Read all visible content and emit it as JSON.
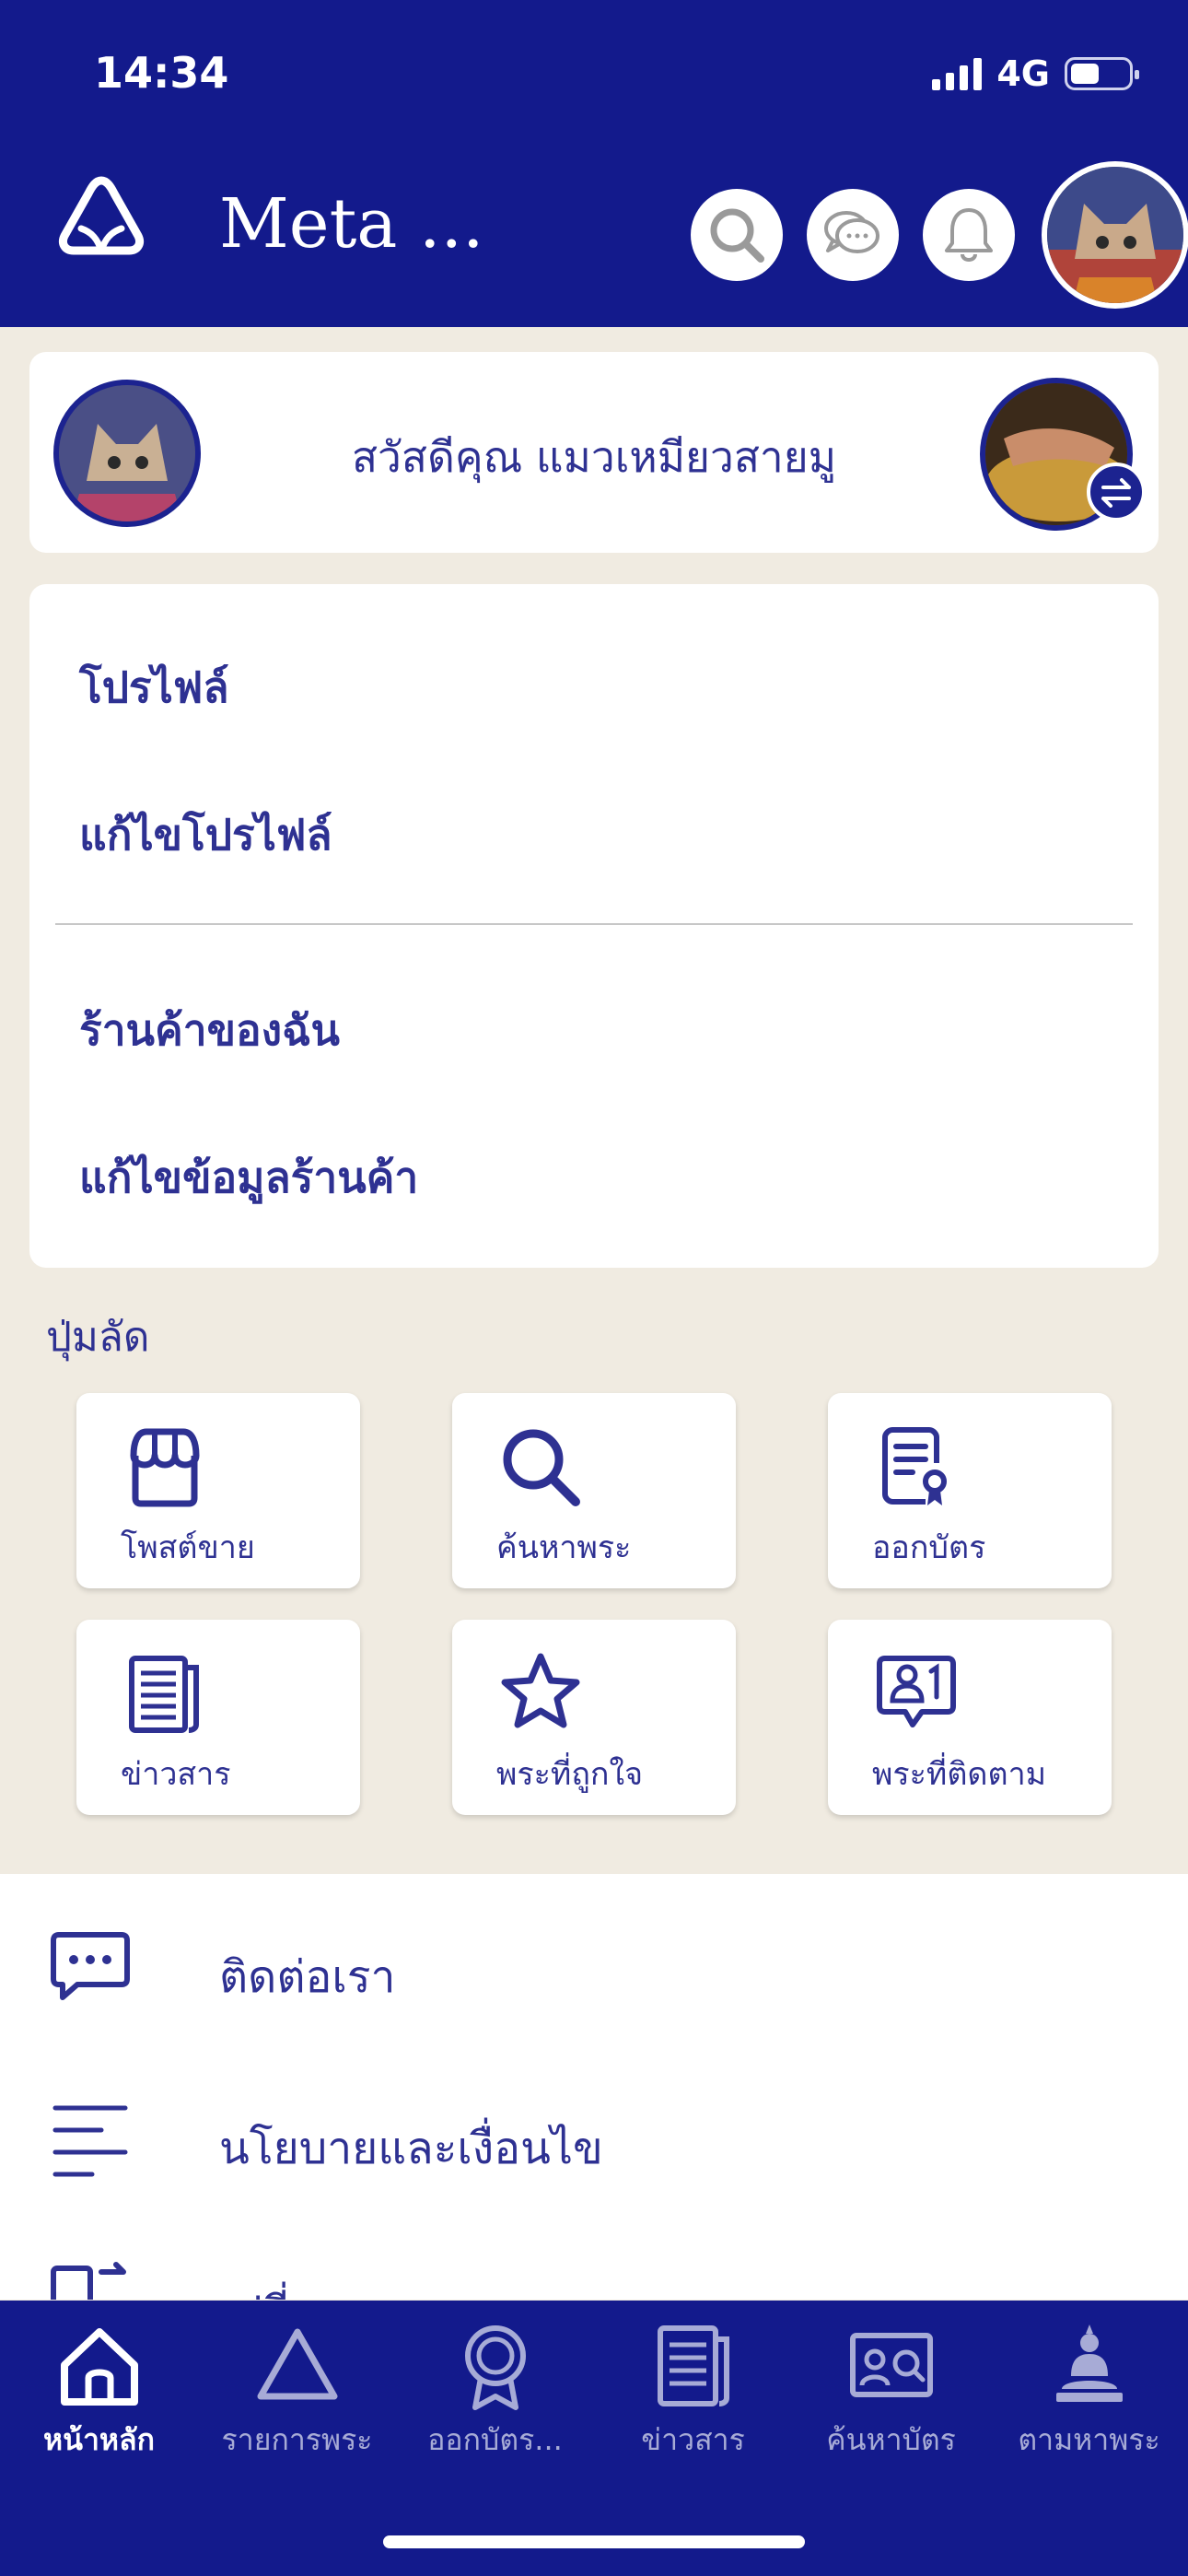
{
  "status_bar": {
    "time": "14:34",
    "network": "4G"
  },
  "app_bar": {
    "title": "Meta ..."
  },
  "greeting": {
    "text": "สวัสดีคุณ แมวเหมียวสายมู"
  },
  "profile_menu": {
    "profile": "โปรไฟล์",
    "edit_profile": "แก้ไขโปรไฟล์",
    "my_shop": "ร้านค้าของฉัน",
    "edit_shop": "แก้ไขข้อมูลร้านค้า"
  },
  "shortcuts": {
    "title": "ปุ่มลัด",
    "items": [
      {
        "label": "โพสต์ขาย",
        "icon": "shop-icon"
      },
      {
        "label": "ค้นหาพระ",
        "icon": "search-icon"
      },
      {
        "label": "ออกบัตร",
        "icon": "certificate-icon"
      },
      {
        "label": "ข่าวสาร",
        "icon": "newspaper-icon"
      },
      {
        "label": "พระที่ถูกใจ",
        "icon": "star-icon"
      },
      {
        "label": "พระที่ติดตาม",
        "icon": "follow-icon"
      }
    ]
  },
  "list": {
    "contact": "ติดต่อเรา",
    "policy": "นโยบายและเงื่อนไข",
    "language": "เปลี่ยนภาษา"
  },
  "tabs": [
    {
      "label": "หน้าหลัก",
      "icon": "home-icon",
      "active": true
    },
    {
      "label": "รายการพระ",
      "icon": "triangle-icon",
      "active": false
    },
    {
      "label": "ออกบัตร...",
      "icon": "badge-icon",
      "active": false
    },
    {
      "label": "ข่าวสาร",
      "icon": "newspaper-icon",
      "active": false
    },
    {
      "label": "ค้นหาบัตร",
      "icon": "card-search-icon",
      "active": false
    },
    {
      "label": "ตามหาพระ",
      "icon": "buddha-icon",
      "active": false
    }
  ],
  "colors": {
    "primary": "#131a8c",
    "accent": "#2e3192",
    "background": "#f0ebe1"
  }
}
